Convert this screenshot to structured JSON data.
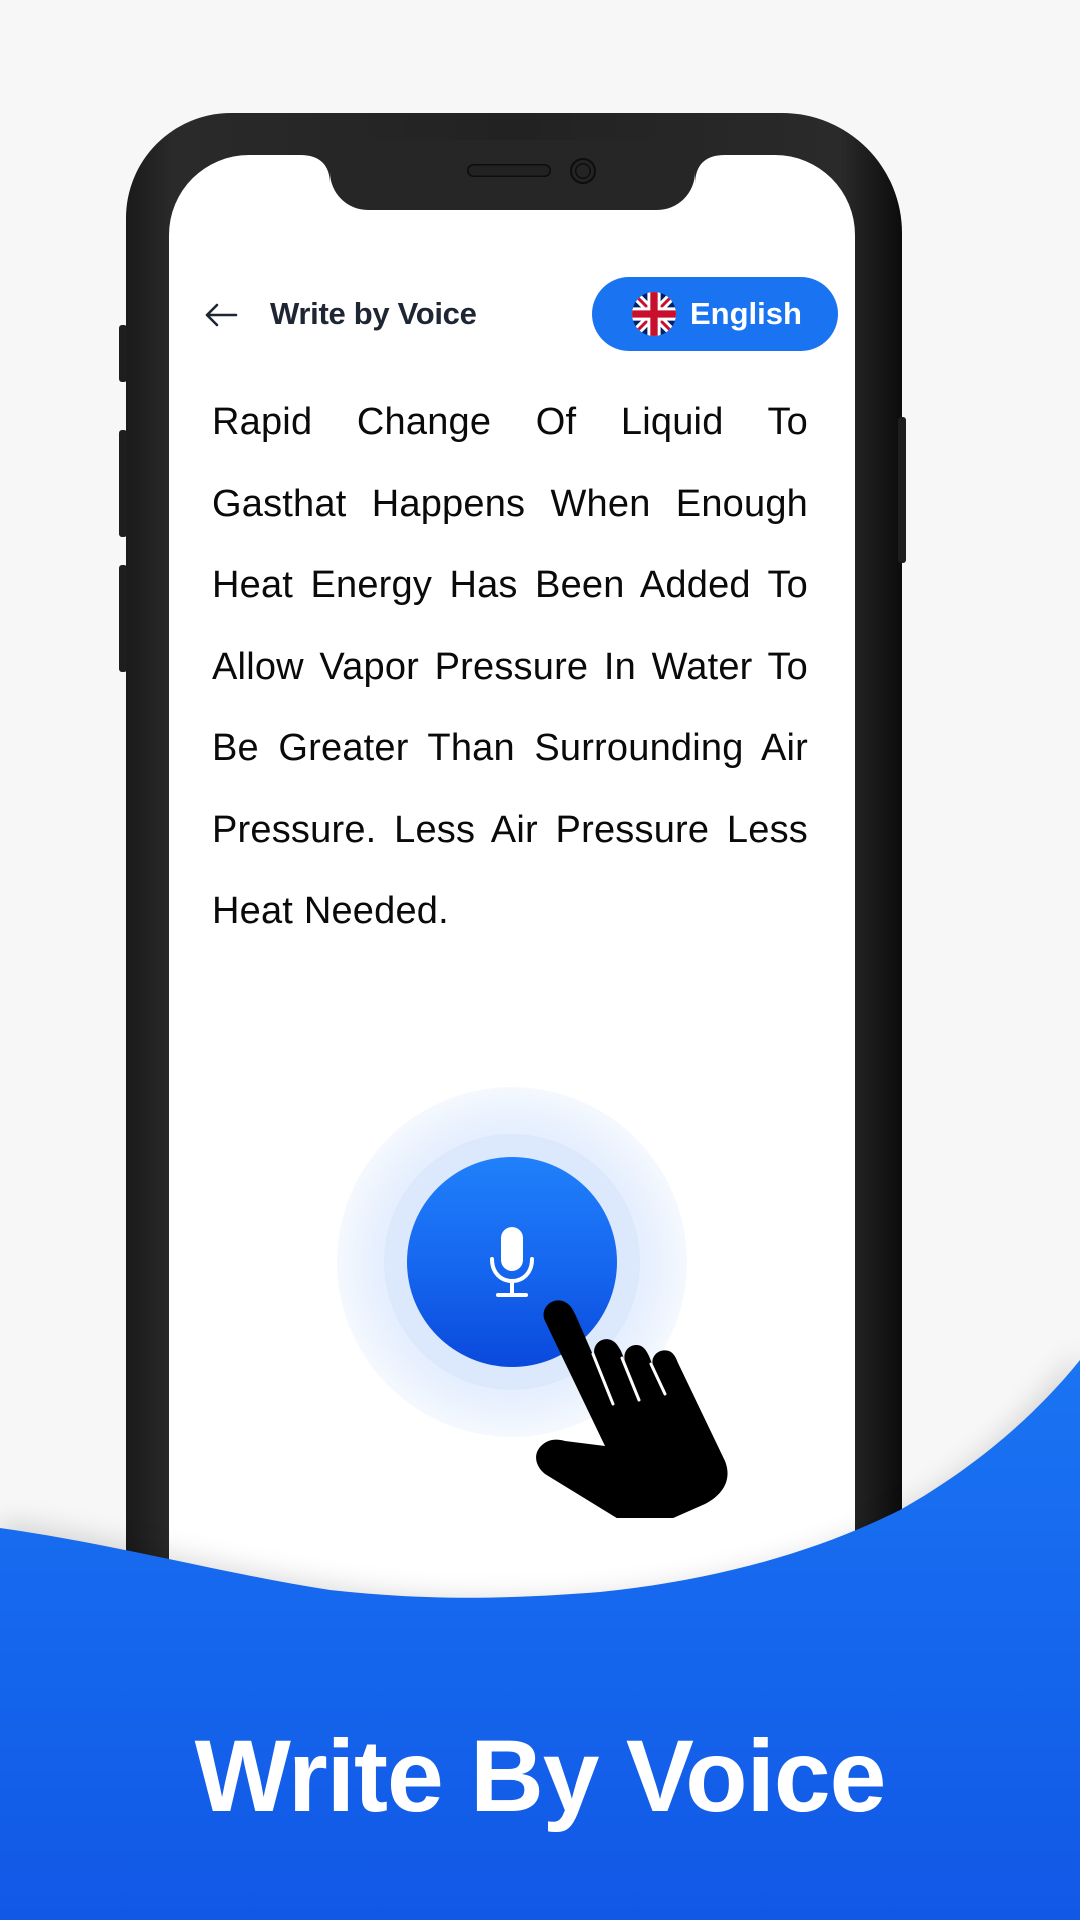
{
  "app": {
    "header": {
      "back_icon": "arrow-left-icon",
      "title": "Write by Voice"
    },
    "language_button": {
      "flag_icon": "uk-flag-icon",
      "label": "English"
    },
    "transcript": {
      "text": "Rapid Change Of Liquid To Gasthat Happens When Enough Heat Energy Has Been Added To Allow Vapor Pressure In Water To Be Greater Than Surrounding Air Pressure. Less Air Pressure Less Heat Needed."
    },
    "mic_button": {
      "icon": "microphone-icon"
    },
    "pointer": {
      "icon": "hand-pointer-icon"
    }
  },
  "banner": {
    "title": "Write By Voice"
  },
  "colors": {
    "accent": "#1a73f0",
    "banner_blue": "#1565ee",
    "text": "#0a0a0a",
    "title_text": "#1e2533",
    "phone_frame": "#232323"
  }
}
